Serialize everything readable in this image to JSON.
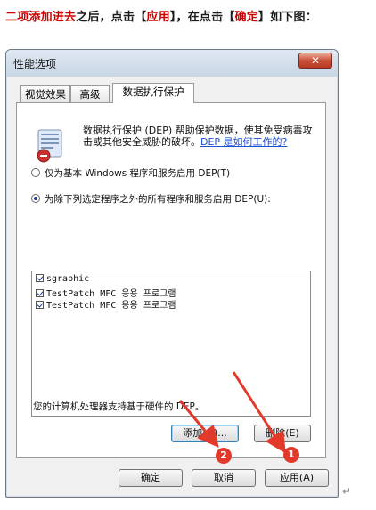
{
  "instruction": {
    "part_red": "二项添加进去",
    "part_plain1": "之后，点击【",
    "apply_word": "应用",
    "part_plain2": "】，在点击【",
    "ok_word": "确定",
    "part_plain3": "】如下图："
  },
  "dialog": {
    "title": "性能选项",
    "close_glyph": "✕",
    "tabs": [
      "视觉效果",
      "高级",
      "数据执行保护"
    ],
    "active_tab": "数据执行保护",
    "description": "数据执行保护 (DEP) 帮助保护数据，使其免受病毒攻击或其他安全威胁的破坏。",
    "dep_link": "DEP 是如何工作的?",
    "radio_options": [
      {
        "label": "仅为基本 Windows 程序和服务启用 DEP(T)",
        "selected": false
      },
      {
        "label": "为除下列选定程序之外的所有程序和服务启用 DEP(U):",
        "selected": true
      }
    ],
    "programs": [
      {
        "name": "sgraphic",
        "checked": true
      },
      {
        "name": "TestPatch MFC 응용 프로그램",
        "checked": true
      },
      {
        "name": "TestPatch MFC 응용 프로그램",
        "checked": true
      }
    ],
    "add_button": "添加(D)...",
    "remove_button": "删除(E)",
    "hw_support_text": "您的计算机处理器支持基于硬件的 DEP。",
    "ok_button": "确定",
    "cancel_button": "取消",
    "apply_button": "应用(A)"
  },
  "annotations": {
    "badge_1": "1",
    "badge_2": "2",
    "arrow_color": "#e23a2a"
  },
  "para_mark": "↵"
}
